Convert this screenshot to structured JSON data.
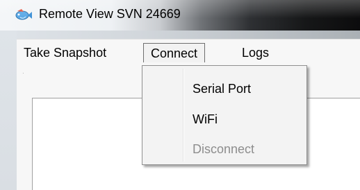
{
  "window": {
    "title": "Remote View SVN 24669",
    "icon": "fish-icon"
  },
  "menubar": {
    "items": [
      {
        "label": "Take Snapshot"
      },
      {
        "label": "Connect"
      },
      {
        "label": "Logs"
      }
    ]
  },
  "connect_menu": {
    "items": [
      {
        "label": "Serial Port",
        "enabled": true
      },
      {
        "label": "WiFi",
        "enabled": true
      },
      {
        "label": "Disconnect",
        "enabled": false
      }
    ]
  },
  "colors": {
    "menu_bg": "#f7f7f7",
    "disabled_text": "#8d8d8d",
    "icon_blue": "#3b8fd6"
  }
}
